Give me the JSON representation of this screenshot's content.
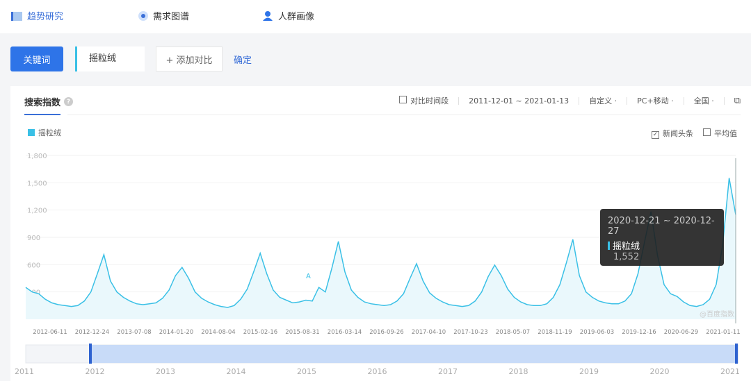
{
  "nav": {
    "items": [
      {
        "label": "趋势研究",
        "icon": "trend-icon",
        "active": true
      },
      {
        "label": "需求图谱",
        "icon": "radar-icon"
      },
      {
        "label": "人群画像",
        "icon": "user-icon"
      }
    ]
  },
  "search": {
    "keyword_button": "关键词",
    "keyword_value": "摇粒绒",
    "add_compare": "+ 添加对比",
    "confirm": "确定"
  },
  "panel": {
    "tab": "搜索指数",
    "help": "?",
    "compare_period": "对比时间段",
    "date_range": "2011-12-01 ~ 2021-01-13",
    "custom": "自定义",
    "device": "PC+移动",
    "region": "全国",
    "news": "新闻头条",
    "news_checked": true,
    "average": "平均值",
    "average_checked": false,
    "watermark": "@百度指数"
  },
  "tooltip": {
    "range": "2020-12-21 ~ 2020-12-27",
    "series": "摇粒绒",
    "value": "1,552"
  },
  "chart_data": {
    "type": "area",
    "series_color": "#3ac0e6",
    "series": [
      {
        "name": "摇粒绒",
        "values": [
          350,
          300,
          280,
          220,
          180,
          160,
          150,
          140,
          150,
          200,
          300,
          500,
          710,
          420,
          300,
          240,
          200,
          170,
          160,
          170,
          180,
          230,
          320,
          480,
          570,
          450,
          300,
          230,
          190,
          160,
          140,
          130,
          150,
          220,
          330,
          520,
          725,
          500,
          320,
          240,
          210,
          180,
          190,
          210,
          200,
          350,
          300,
          560,
          855,
          520,
          320,
          240,
          190,
          170,
          160,
          150,
          160,
          200,
          280,
          450,
          610,
          420,
          290,
          230,
          190,
          160,
          150,
          140,
          150,
          200,
          300,
          470,
          595,
          480,
          330,
          240,
          190,
          160,
          150,
          150,
          170,
          240,
          380,
          620,
          877,
          480,
          300,
          240,
          200,
          180,
          170,
          170,
          200,
          280,
          500,
          850,
          1183,
          700,
          380,
          280,
          250,
          190,
          150,
          140,
          160,
          220,
          380,
          820,
          1552,
          1150
        ]
      }
    ],
    "x_start": "2011-12",
    "x_end": "2021-01",
    "x_step": "month",
    "ylim": [
      0,
      1800
    ],
    "yticks": [
      "1,800",
      "1,500",
      "1,200",
      "900",
      "600",
      "300"
    ],
    "yticks_values": [
      1800,
      1500,
      1200,
      900,
      600,
      300
    ],
    "xticks": [
      "2012-06-11",
      "2012-12-24",
      "2013-07-08",
      "2014-01-20",
      "2014-08-04",
      "2015-02-16",
      "2015-08-31",
      "2016-03-14",
      "2016-09-26",
      "2017-04-10",
      "2017-10-23",
      "2018-05-07",
      "2018-11-19",
      "2019-06-03",
      "2019-12-16",
      "2020-06-29",
      "2021-01-11"
    ],
    "annotation": "A",
    "minimap_years": [
      "2011",
      "2012",
      "2013",
      "2014",
      "2015",
      "2016",
      "2017",
      "2018",
      "2019",
      "2020",
      "2021"
    ]
  }
}
